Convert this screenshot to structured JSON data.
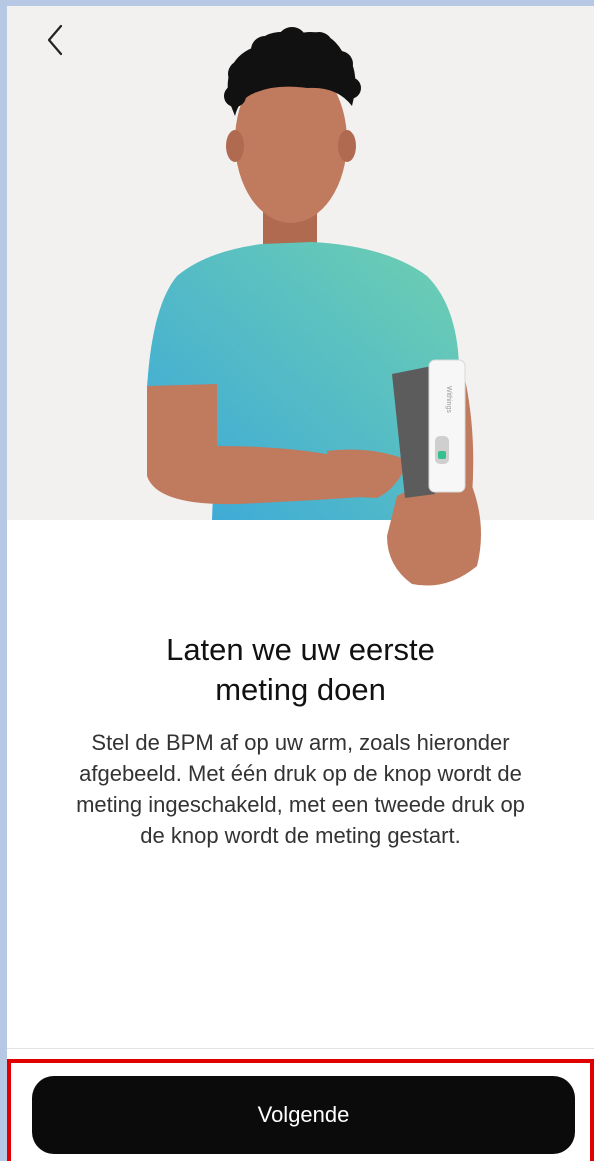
{
  "header": {
    "back_icon": "chevron-left-icon"
  },
  "content": {
    "title_lines": [
      "Laten we uw eerste",
      "meting doen"
    ],
    "description_lines": [
      "Stel de BPM af op uw arm, zoals hieronder",
      "afgebeeld. Met één druk op de knop wordt de",
      "meting ingeschakeld, met een tweede druk op",
      "de knop wordt de meting gestart."
    ],
    "device_brand": "Withings"
  },
  "footer": {
    "next_label": "Volgende"
  },
  "colors": {
    "hero_background": "#f3f1ef",
    "button_background": "#0b0b0b",
    "highlight_border": "#e00000",
    "shirt_gradient_start": "#6fd0b0",
    "shirt_gradient_end": "#3aa7db",
    "skin": "#c07a5e",
    "hair": "#111111"
  }
}
